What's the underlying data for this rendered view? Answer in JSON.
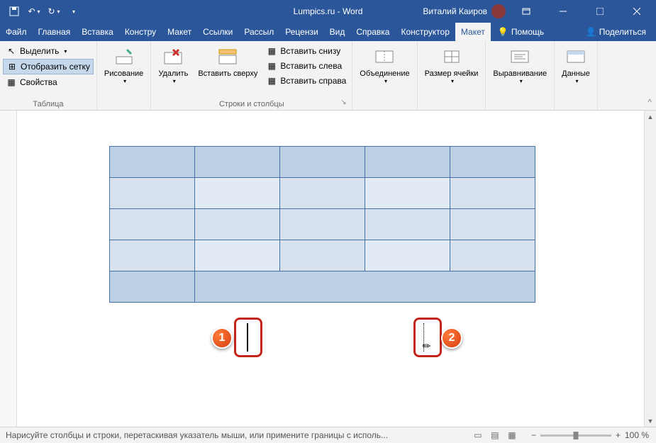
{
  "title": "Lumpics.ru - Word",
  "user": "Виталий Каиров",
  "tabs": {
    "file": "Файл",
    "home": "Главная",
    "insert": "Вставка",
    "design": "Констру",
    "layout": "Макет",
    "refs": "Ссылки",
    "mail": "Рассыл",
    "review": "Рецензи",
    "view": "Вид",
    "help": "Справка",
    "tbl_design": "Конструктор",
    "tbl_layout": "Макет",
    "tell": "Помощь",
    "share": "Поделиться"
  },
  "ribbon": {
    "table_group": "Таблица",
    "select": "Выделить",
    "gridlines": "Отобразить сетку",
    "properties": "Свойства",
    "draw": "Рисование",
    "delete": "Удалить",
    "insert_above": "Вставить сверху",
    "insert_below": "Вставить снизу",
    "insert_left": "Вставить слева",
    "insert_right": "Вставить справа",
    "rows_cols": "Строки и столбцы",
    "merge": "Объединение",
    "cellsize": "Размер ячейки",
    "align": "Выравнивание",
    "data": "Данные"
  },
  "callouts": {
    "one": "1",
    "two": "2"
  },
  "status": {
    "text": "Нарисуйте столбцы и строки, перетаскивая указатель мыши, или примените границы с исполь...",
    "zoom": "100 %"
  }
}
